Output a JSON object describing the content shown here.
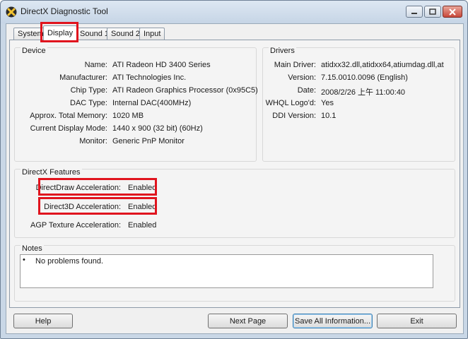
{
  "window": {
    "title": "DirectX Diagnostic Tool"
  },
  "tabs": [
    {
      "label": "System"
    },
    {
      "label": "Display"
    },
    {
      "label": "Sound 1"
    },
    {
      "label": "Sound 2"
    },
    {
      "label": "Input"
    }
  ],
  "device": {
    "title": "Device",
    "name_label": "Name:",
    "name": "ATI Radeon HD 3400 Series",
    "manufacturer_label": "Manufacturer:",
    "manufacturer": "ATI Technologies Inc.",
    "chip_label": "Chip Type:",
    "chip": "ATI Radeon Graphics Processor (0x95C5)",
    "dac_label": "DAC Type:",
    "dac": "Internal DAC(400MHz)",
    "memory_label": "Approx. Total Memory:",
    "memory": "1020 MB",
    "mode_label": "Current Display Mode:",
    "mode": "1440 x 900 (32 bit) (60Hz)",
    "monitor_label": "Monitor:",
    "monitor": "Generic PnP Monitor"
  },
  "drivers": {
    "title": "Drivers",
    "main_label": "Main Driver:",
    "main": "atidxx32.dll,atidxx64,atiumdag.dll,at",
    "version_label": "Version:",
    "version": "7.15.0010.0096 (English)",
    "date_label": "Date:",
    "date": "2008/2/26 上午 11:00:40",
    "whql_label": "WHQL Logo'd:",
    "whql": "Yes",
    "ddi_label": "DDI Version:",
    "ddi": "10.1"
  },
  "features": {
    "title": "DirectX Features",
    "directdraw_label": "DirectDraw Acceleration:",
    "directdraw": "Enabled",
    "direct3d_label": "Direct3D Acceleration:",
    "direct3d": "Enabled",
    "agp_label": "AGP Texture Acceleration:",
    "agp": "Enabled"
  },
  "notes": {
    "title": "Notes",
    "items": [
      "No problems found."
    ]
  },
  "buttons": {
    "help": "Help",
    "next": "Next Page",
    "save": "Save All Information...",
    "exit": "Exit"
  },
  "colors": {
    "highlight": "#e0141e",
    "client_bg": "#f0f0f0",
    "frame": "#c9d7e6"
  }
}
